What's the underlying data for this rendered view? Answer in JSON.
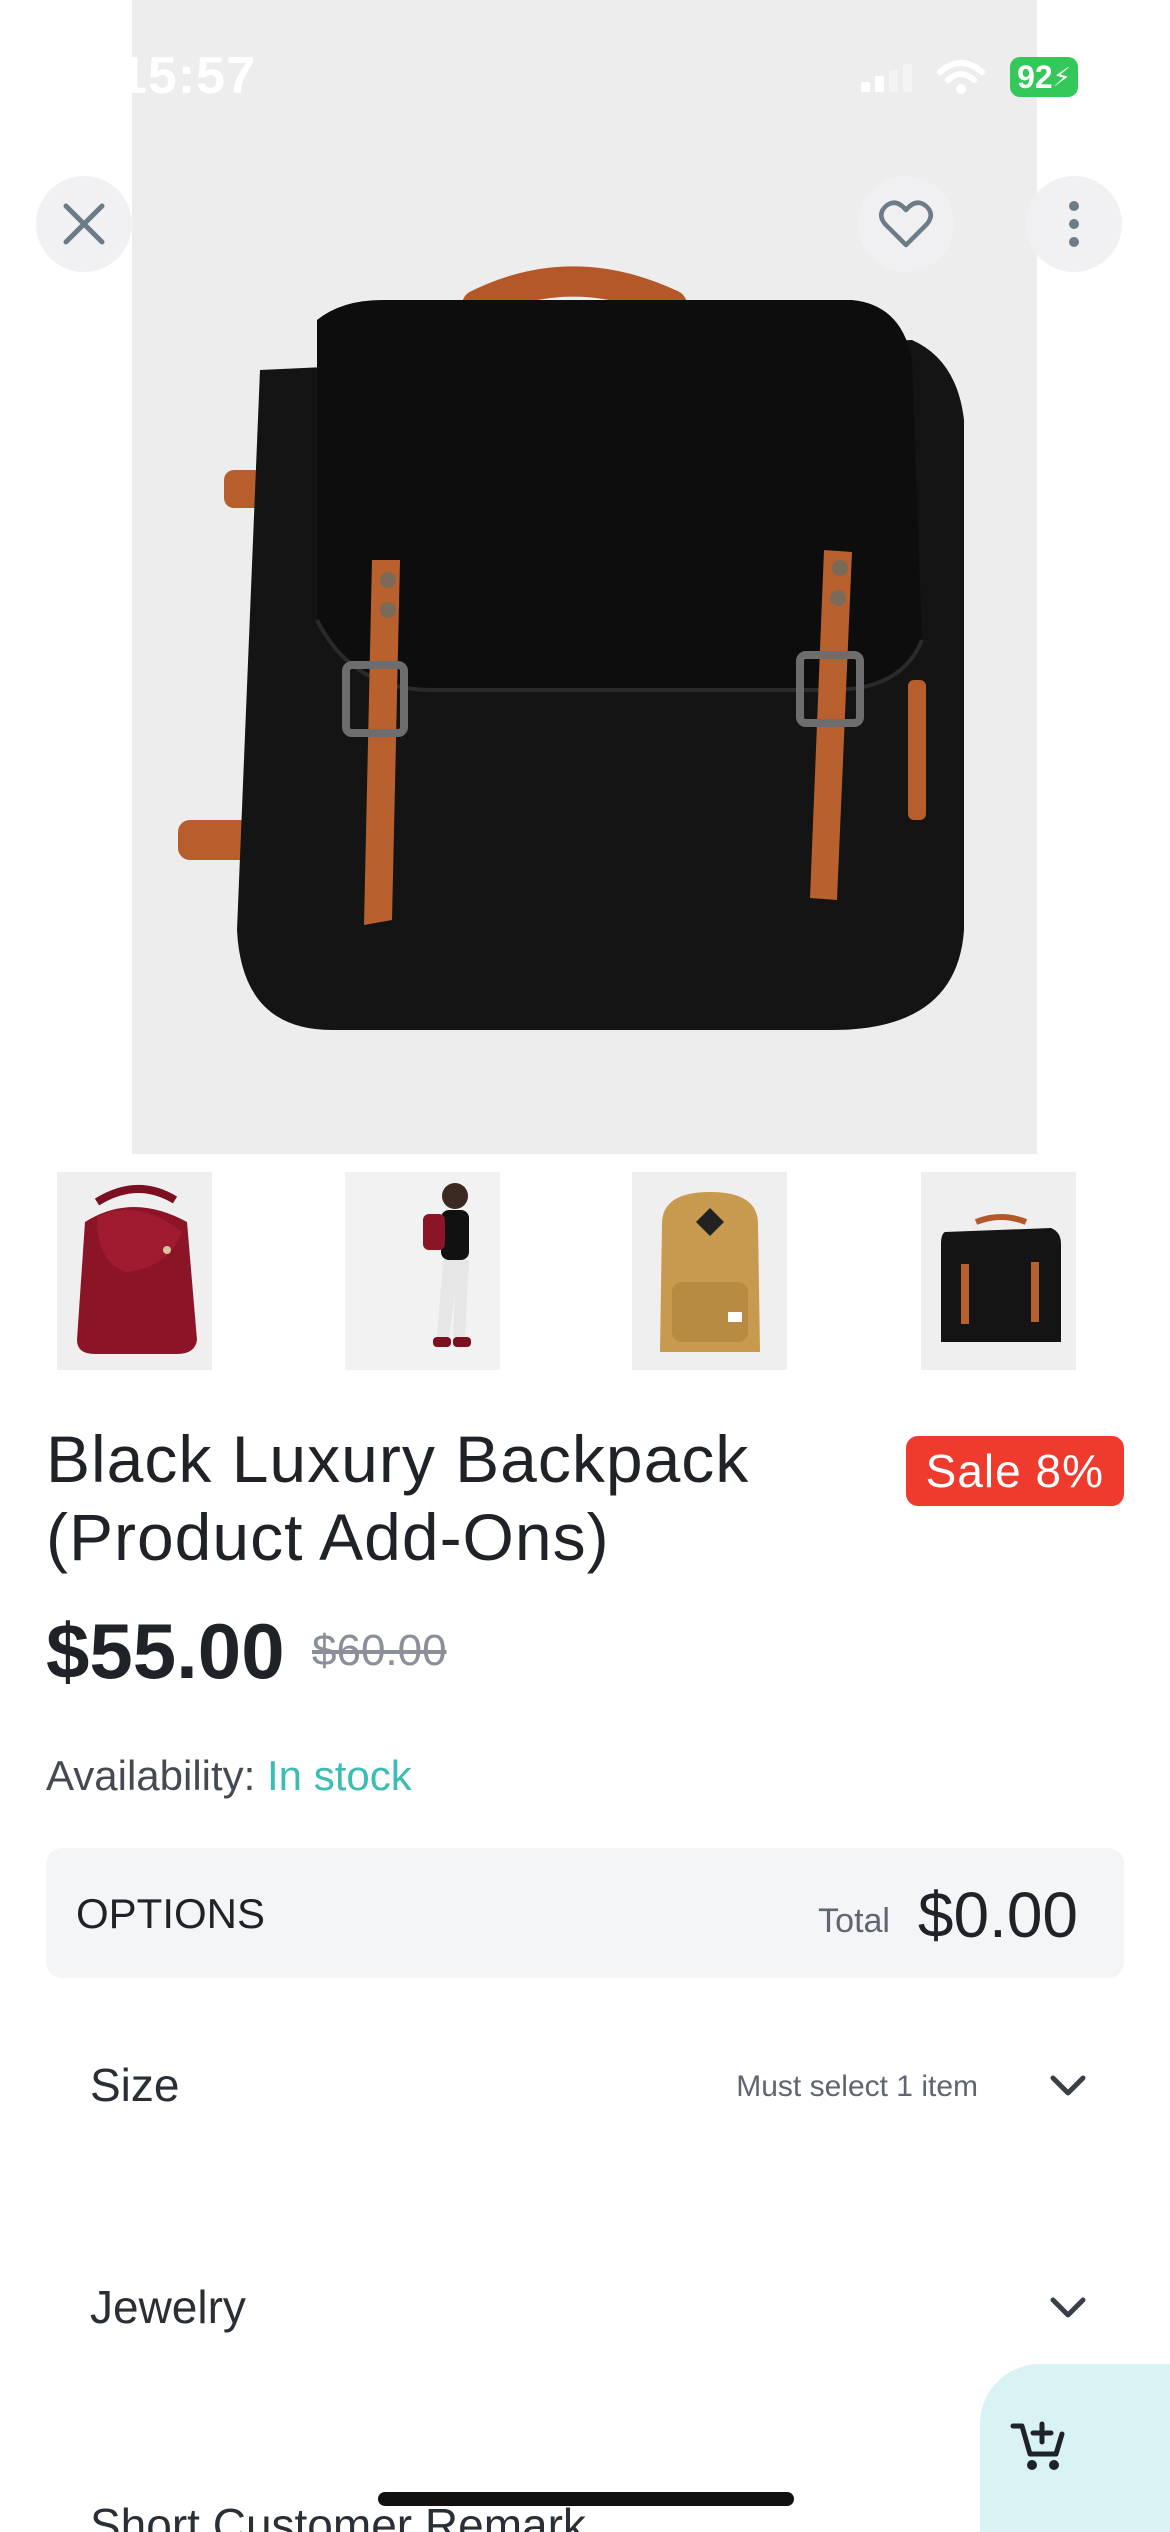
{
  "status_bar": {
    "time": "15:57",
    "battery": "92"
  },
  "actions": {
    "close_icon": "close-icon",
    "favorite_icon": "heart-outline-icon",
    "more_icon": "more-vertical-icon"
  },
  "product": {
    "title": "Black Luxury Backpack (Product Add-Ons)",
    "sale_badge": "Sale 8%",
    "price": "$55.00",
    "old_price": "$60.00",
    "availability_label": "Availability:",
    "availability_value": "In stock",
    "thumbnails": [
      "burgundy backpack",
      "model wearing backpack",
      "tan backpack",
      "black backpack"
    ]
  },
  "options": {
    "label": "OPTIONS",
    "total_label": "Total",
    "total_value": "$0.00",
    "rows": [
      {
        "name": "Size",
        "hint": "Must select 1 item"
      },
      {
        "name": "Jewelry",
        "hint": ""
      },
      {
        "name": "Short Customer Remark",
        "hint": ""
      }
    ]
  },
  "cart": {
    "icon": "add-to-cart-icon"
  },
  "colors": {
    "sale": "#ef3b2d",
    "in_stock": "#3bbcb4",
    "cart_bg": "#d9f2f4",
    "battery": "#34c759"
  }
}
